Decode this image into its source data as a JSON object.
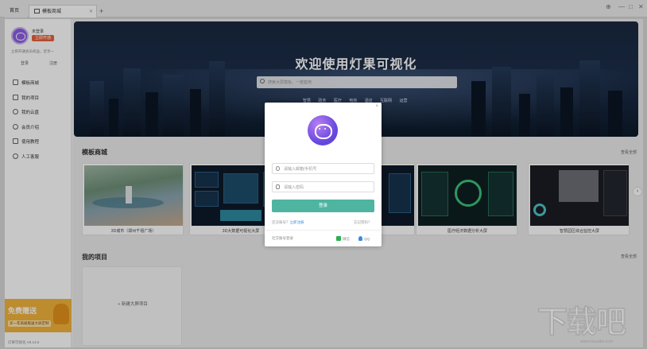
{
  "tabs": [
    {
      "label": "首页"
    },
    {
      "label": "模板商城"
    }
  ],
  "window_controls": {
    "menu": "⊕",
    "minimize": "—",
    "maximize": "□",
    "close": "✕"
  },
  "sidebar": {
    "user_name": "未登录",
    "member_badge": "立即开通",
    "user_hint": "立即开通会员权益，近享一",
    "links": [
      "登录",
      "注册"
    ],
    "items": [
      {
        "label": "模板商城"
      },
      {
        "label": "我的项目"
      },
      {
        "label": "我的云盘"
      },
      {
        "label": "会员介绍"
      },
      {
        "label": "使用教程"
      },
      {
        "label": "人工客服"
      }
    ],
    "promo_title": "免费赠送",
    "promo_sub": "买一年高级版送大屏定制",
    "version": "灯果可视化 V6.13.6"
  },
  "banner": {
    "title": "欢迎使用灯果可视化",
    "search_placeholder": "搜索大屏模板，一键套用",
    "hot_tags": [
      "智慧",
      "政务",
      "医疗",
      "电商",
      "酒店",
      "互联网",
      "运营"
    ]
  },
  "templates": {
    "title": "模板商城",
    "see_all": "查看全部",
    "cards": [
      {
        "caption": "3D城市（郑州千禧广场）"
      },
      {
        "caption": "3D大数据可视化大屏"
      },
      {
        "caption": ""
      },
      {
        "caption": ""
      },
      {
        "caption": "医疗经济数据分析大屏"
      },
      {
        "caption": "智慧园区综合监控大屏"
      }
    ],
    "next_arrow": "›"
  },
  "projects": {
    "title": "我的项目",
    "see_all": "查看全部",
    "new_label": "+ 新建大屏项目"
  },
  "login_modal": {
    "close": "×",
    "account_placeholder": "请输入邮箱/手机号",
    "password_placeholder": "请输入密码",
    "login_button": "登录",
    "no_account": "还没账号？",
    "register_link": "立即注册",
    "forgot": "忘记密码？",
    "other_login": "社交账号登录",
    "wechat": "微信",
    "qq": "QQ"
  },
  "watermark": {
    "text": "下载吧",
    "url": "www.xiazaiba.com"
  },
  "colors": {
    "accent": "#4fb4a0",
    "badge": "#e8603c",
    "promo": "#f3b43d",
    "logo": "#6b4ae0"
  }
}
